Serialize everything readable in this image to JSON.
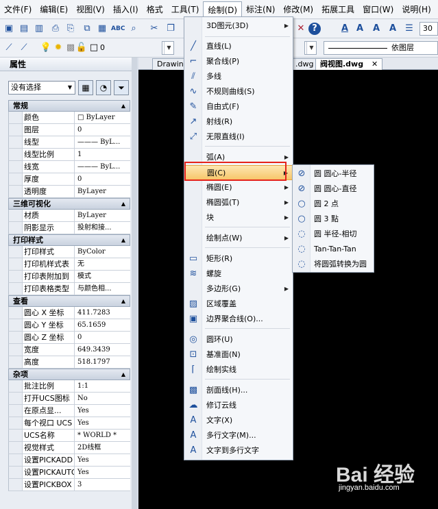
{
  "menubar": {
    "items": [
      {
        "label": "文件(F)"
      },
      {
        "label": "编辑(E)"
      },
      {
        "label": "视图(V)"
      },
      {
        "label": "插入(I)"
      },
      {
        "label": "格式"
      },
      {
        "label": "工具(T)"
      },
      {
        "label": "绘制(D)"
      },
      {
        "label": "标注(N)"
      },
      {
        "label": "修改(M)"
      },
      {
        "label": "拓展工具"
      },
      {
        "label": "窗口(W)"
      },
      {
        "label": "说明(H)"
      }
    ]
  },
  "toolbar": {
    "layer_value": "0",
    "linetype_value": "依图层",
    "zoom_value": "30"
  },
  "properties": {
    "title": "属性",
    "selection": "没有选择",
    "sections": [
      {
        "title": "常规",
        "rows": [
          {
            "name": "颜色",
            "value": "□ ByLayer"
          },
          {
            "name": "图层",
            "value": "0"
          },
          {
            "name": "线型",
            "value": "——— ByL..."
          },
          {
            "name": "线型比例",
            "value": "1"
          },
          {
            "name": "线宽",
            "value": "——— ByL..."
          },
          {
            "name": "厚度",
            "value": "0"
          },
          {
            "name": "透明度",
            "value": "ByLayer"
          }
        ]
      },
      {
        "title": "三维可视化",
        "rows": [
          {
            "name": "材质",
            "value": "ByLayer"
          },
          {
            "name": "阴影显示",
            "value": "投射和接..."
          }
        ]
      },
      {
        "title": "打印样式",
        "rows": [
          {
            "name": "打印样式",
            "value": "ByColor"
          },
          {
            "name": "打印机样式表",
            "value": "无"
          },
          {
            "name": "打印表附加到",
            "value": "模式"
          },
          {
            "name": "打印表格类型",
            "value": "与颜色相..."
          }
        ]
      },
      {
        "title": "查看",
        "rows": [
          {
            "name": "圆心 X 坐标",
            "value": "411.7283"
          },
          {
            "name": "圆心 Y 坐标",
            "value": "65.1659"
          },
          {
            "name": "圆心 Z 坐标",
            "value": "0"
          },
          {
            "name": "宽度",
            "value": "649.3439"
          },
          {
            "name": "高度",
            "value": "518.1797"
          }
        ]
      },
      {
        "title": "杂项",
        "rows": [
          {
            "name": "批注比例",
            "value": "1:1"
          },
          {
            "name": "打开UCS图标",
            "value": "No"
          },
          {
            "name": "在原点显...",
            "value": "Yes"
          },
          {
            "name": "每个视口 UCS",
            "value": "Yes"
          },
          {
            "name": "UCS名称",
            "value": "* WORLD *"
          },
          {
            "name": "视觉样式",
            "value": "2D线框"
          },
          {
            "name": "设置PICKADD",
            "value": "Yes"
          },
          {
            "name": "设置PICKAUTO",
            "value": "Yes"
          },
          {
            "name": "设置PICKBOX",
            "value": "3"
          }
        ]
      }
    ]
  },
  "tabs": [
    {
      "label": "Drawing"
    },
    {
      "label": ".dwg"
    },
    {
      "label": "阀视图.dwg"
    }
  ],
  "draw_menu": [
    {
      "label": "3D图元(3D)",
      "icon": "none",
      "sub": true
    },
    {
      "label": "直线(L)",
      "icon": "line-icon"
    },
    {
      "label": "聚合线(P)",
      "icon": "polyline-icon"
    },
    {
      "label": "多线",
      "icon": "multiline-icon"
    },
    {
      "label": "不规则曲线(S)",
      "icon": "spline-icon"
    },
    {
      "label": "自由式(F)",
      "icon": "freehand-icon"
    },
    {
      "label": "射线(R)",
      "icon": "ray-icon"
    },
    {
      "label": "无限直线(I)",
      "icon": "xline-icon"
    },
    {
      "label": "弧(A)",
      "icon": "none",
      "sub": true
    },
    {
      "label": "圆(C)",
      "icon": "none",
      "sub": true,
      "highlight": true
    },
    {
      "label": "椭圆(E)",
      "icon": "none",
      "sub": true
    },
    {
      "label": "椭圆弧(T)",
      "icon": "none",
      "sub": true
    },
    {
      "label": "块",
      "icon": "none",
      "sub": true
    },
    {
      "label": "绘制点(W)",
      "icon": "none",
      "sub": true
    },
    {
      "label": "矩形(R)",
      "icon": "rectangle-icon"
    },
    {
      "label": "螺旋",
      "icon": "helix-icon"
    },
    {
      "label": "多边形(G)",
      "icon": "none",
      "sub": true
    },
    {
      "label": "区域覆盖",
      "icon": "wipeout-icon"
    },
    {
      "label": "边界聚合线(O)...",
      "icon": "boundary-icon"
    },
    {
      "label": "圆环(U)",
      "icon": "donut-icon"
    },
    {
      "label": "基准面(N)",
      "icon": "plane-icon"
    },
    {
      "label": "绘制实线",
      "icon": "solid-icon"
    },
    {
      "label": "剖面线(H)...",
      "icon": "hatch-icon"
    },
    {
      "label": "修订云线",
      "icon": "revcloud-icon"
    },
    {
      "label": "文字(X)",
      "icon": "text-icon"
    },
    {
      "label": "多行文字(M)...",
      "icon": "mtext-icon"
    },
    {
      "label": "文字到多行文字",
      "icon": "text-to-mtext-icon"
    }
  ],
  "circle_submenu": [
    {
      "label": "圆 圆心-半径"
    },
    {
      "label": "圆 圆心-直径"
    },
    {
      "label": "圆 2 点"
    },
    {
      "label": "圆 3 點"
    },
    {
      "label": "圆 半径-相切"
    },
    {
      "label": "Tan-Tan-Tan"
    },
    {
      "label": "将圆弧转换为圆"
    }
  ],
  "watermark": {
    "brand": "Bai 经验",
    "url": "jingyan.baidu.com"
  },
  "colors": {
    "highlight": "#f7c66a",
    "annotation": "#e5231b",
    "canvas": "#000000"
  }
}
